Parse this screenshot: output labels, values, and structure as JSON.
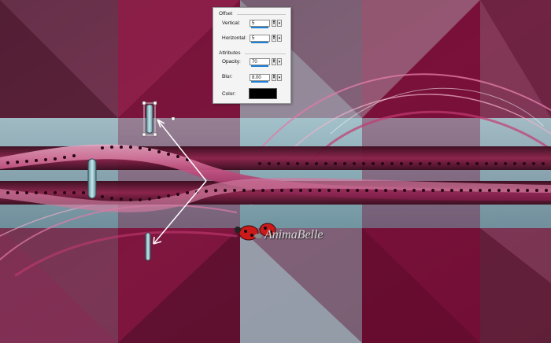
{
  "dialog": {
    "offset_title": "Offset",
    "vertical_label": "Vertical:",
    "vertical_value": "5",
    "horizontal_label": "Horizontal:",
    "horizontal_value": "5",
    "attributes_title": "Attributes",
    "opacity_label": "Opacity:",
    "opacity_value": "70",
    "blur_label": "Blur:",
    "blur_value": "8.00",
    "color_label": "Color:",
    "shadow_color": "#000000"
  },
  "watermark": "AnimaBelle",
  "colors": {
    "wine": "#7a0f3a",
    "dark_wine": "#4d0c26",
    "teal": "#8fc3cc",
    "pink": "#d8508a"
  }
}
